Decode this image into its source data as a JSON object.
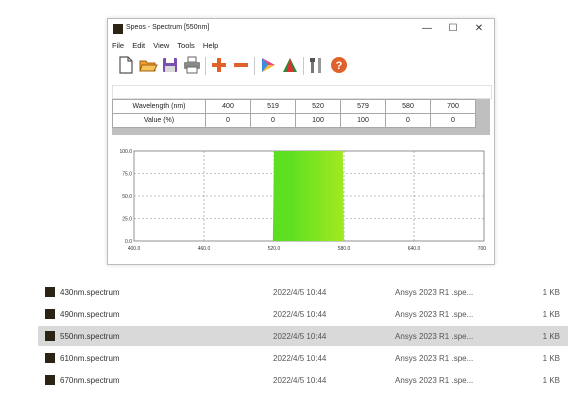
{
  "window": {
    "title": "Speos - Spectrum [550nm]",
    "minimize": "—",
    "maximize": "☐",
    "close": "✕"
  },
  "menu": [
    {
      "label": "File"
    },
    {
      "label": "Edit"
    },
    {
      "label": "View"
    },
    {
      "label": "Tools"
    },
    {
      "label": "Help"
    }
  ],
  "toolbar_icons": [
    "new-icon",
    "open-icon",
    "save-icon",
    "print-icon",
    "add-icon",
    "remove-icon",
    "color-icon",
    "spectrum-icon",
    "tools-icon",
    "help-icon"
  ],
  "spectrum_table": {
    "row_labels": [
      "Wavelength (nm)",
      "Value (%)"
    ],
    "wavelengths": [
      "400",
      "519",
      "520",
      "579",
      "580",
      "700"
    ],
    "values": [
      "0",
      "0",
      "100",
      "100",
      "0",
      "0"
    ]
  },
  "chart_data": {
    "type": "area",
    "x": [
      400,
      519,
      520,
      579,
      580,
      700
    ],
    "y": [
      0,
      0,
      100,
      100,
      0,
      0
    ],
    "xlim": [
      400,
      700
    ],
    "ylim": [
      0,
      100
    ],
    "xticks": [
      "400.0",
      "460.0",
      "520.0",
      "580.0",
      "640.0",
      "700.0"
    ],
    "yticks": [
      "0.0",
      "25.0",
      "50.0",
      "75.0",
      "100.0"
    ],
    "grid": true
  },
  "files": [
    {
      "name": "430nm.spectrum",
      "date": "2022/4/5 10:44",
      "type": "Ansys 2023 R1 .spe...",
      "size": "1 KB",
      "selected": false
    },
    {
      "name": "490nm.spectrum",
      "date": "2022/4/5 10:44",
      "type": "Ansys 2023 R1 .spe...",
      "size": "1 KB",
      "selected": false
    },
    {
      "name": "550nm.spectrum",
      "date": "2022/4/5 10:44",
      "type": "Ansys 2023 R1 .spe...",
      "size": "1 KB",
      "selected": true
    },
    {
      "name": "610nm.spectrum",
      "date": "2022/4/5 10:44",
      "type": "Ansys 2023 R1 .spe...",
      "size": "1 KB",
      "selected": false
    },
    {
      "name": "670nm.spectrum",
      "date": "2022/4/5 10:44",
      "type": "Ansys 2023 R1 .spe...",
      "size": "1 KB",
      "selected": false
    }
  ]
}
